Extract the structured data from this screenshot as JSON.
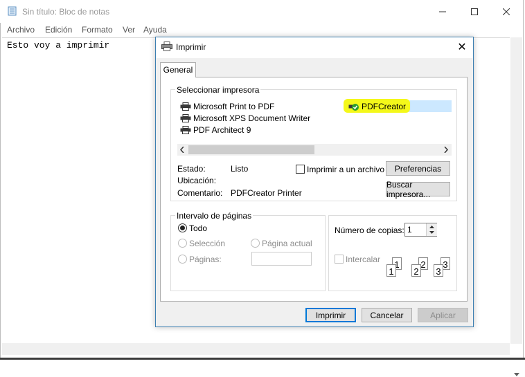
{
  "notepad": {
    "title": "Sin título: Bloc de notas",
    "menu": [
      "Archivo",
      "Edición",
      "Formato",
      "Ver",
      "Ayuda"
    ],
    "content": "Esto voy a imprimir",
    "caption_buttons": {
      "minimize": "—",
      "maximize": "☐",
      "close": "✕"
    }
  },
  "dialog": {
    "title": "Imprimir",
    "close_glyph": "✕",
    "tab": "General",
    "select_printer_label": "Seleccionar impresora",
    "printers": [
      {
        "name": "Microsoft Print to PDF"
      },
      {
        "name": "Microsoft XPS Document Writer"
      },
      {
        "name": "PDF Architect 9"
      },
      {
        "name": "PDFCreator",
        "selected": true
      }
    ],
    "status": {
      "label": "Estado:",
      "value": "Listo"
    },
    "location": {
      "label": "Ubicación:",
      "value": ""
    },
    "comment": {
      "label": "Comentario:",
      "value": "PDFCreator Printer"
    },
    "print_to_file": {
      "label": "Imprimir a un archivo",
      "checked": false
    },
    "preferences_button": "Preferencias",
    "find_printer_button": "Buscar impresora...",
    "page_range": {
      "label": "Intervalo de páginas",
      "all": "Todo",
      "selection": "Selección",
      "current_page": "Página actual",
      "pages": "Páginas:",
      "pages_value": "",
      "selected_option": "all"
    },
    "copies": {
      "label": "Número de copias:",
      "value": "1",
      "collate_label": "Intercalar",
      "collate_checked": false,
      "collate_pages": [
        "1",
        "1",
        "2",
        "2",
        "3",
        "3"
      ]
    },
    "buttons": {
      "print": "Imprimir",
      "cancel": "Cancelar",
      "apply": "Aplicar"
    }
  },
  "colors": {
    "highlight": "#cce8ff",
    "annotation": "#f4f81a",
    "accent": "#0078d7",
    "check_green": "#2e9e2e"
  }
}
